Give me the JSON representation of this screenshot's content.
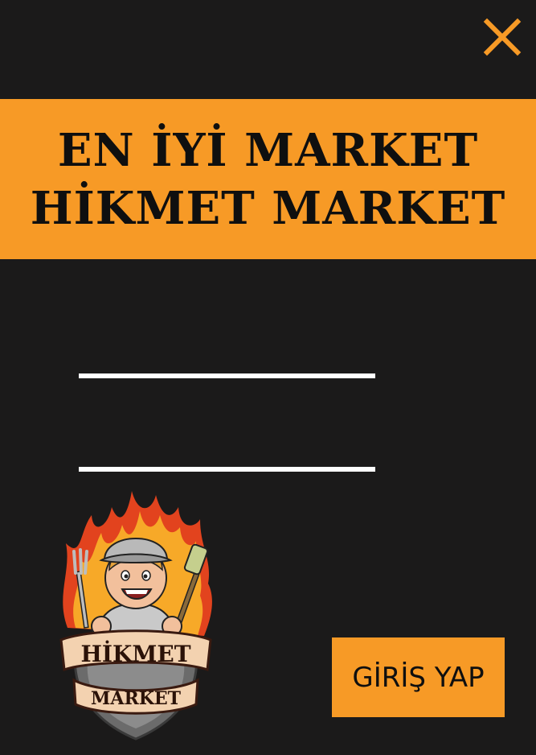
{
  "banner": {
    "line1": "EN İYİ MARKET",
    "line2": "HİKMET MARKET"
  },
  "form": {
    "username_value": "",
    "password_value": ""
  },
  "logo": {
    "text_top": "HİKMET",
    "text_bottom": "MARKET"
  },
  "login_button": {
    "label": "GİRİŞ YAP"
  },
  "colors": {
    "background": "#1b1a1a",
    "accent": "#f79a26",
    "text_dark": "#0f0f0f",
    "field_line": "#ffffff"
  },
  "icons": {
    "close": "close-icon"
  }
}
